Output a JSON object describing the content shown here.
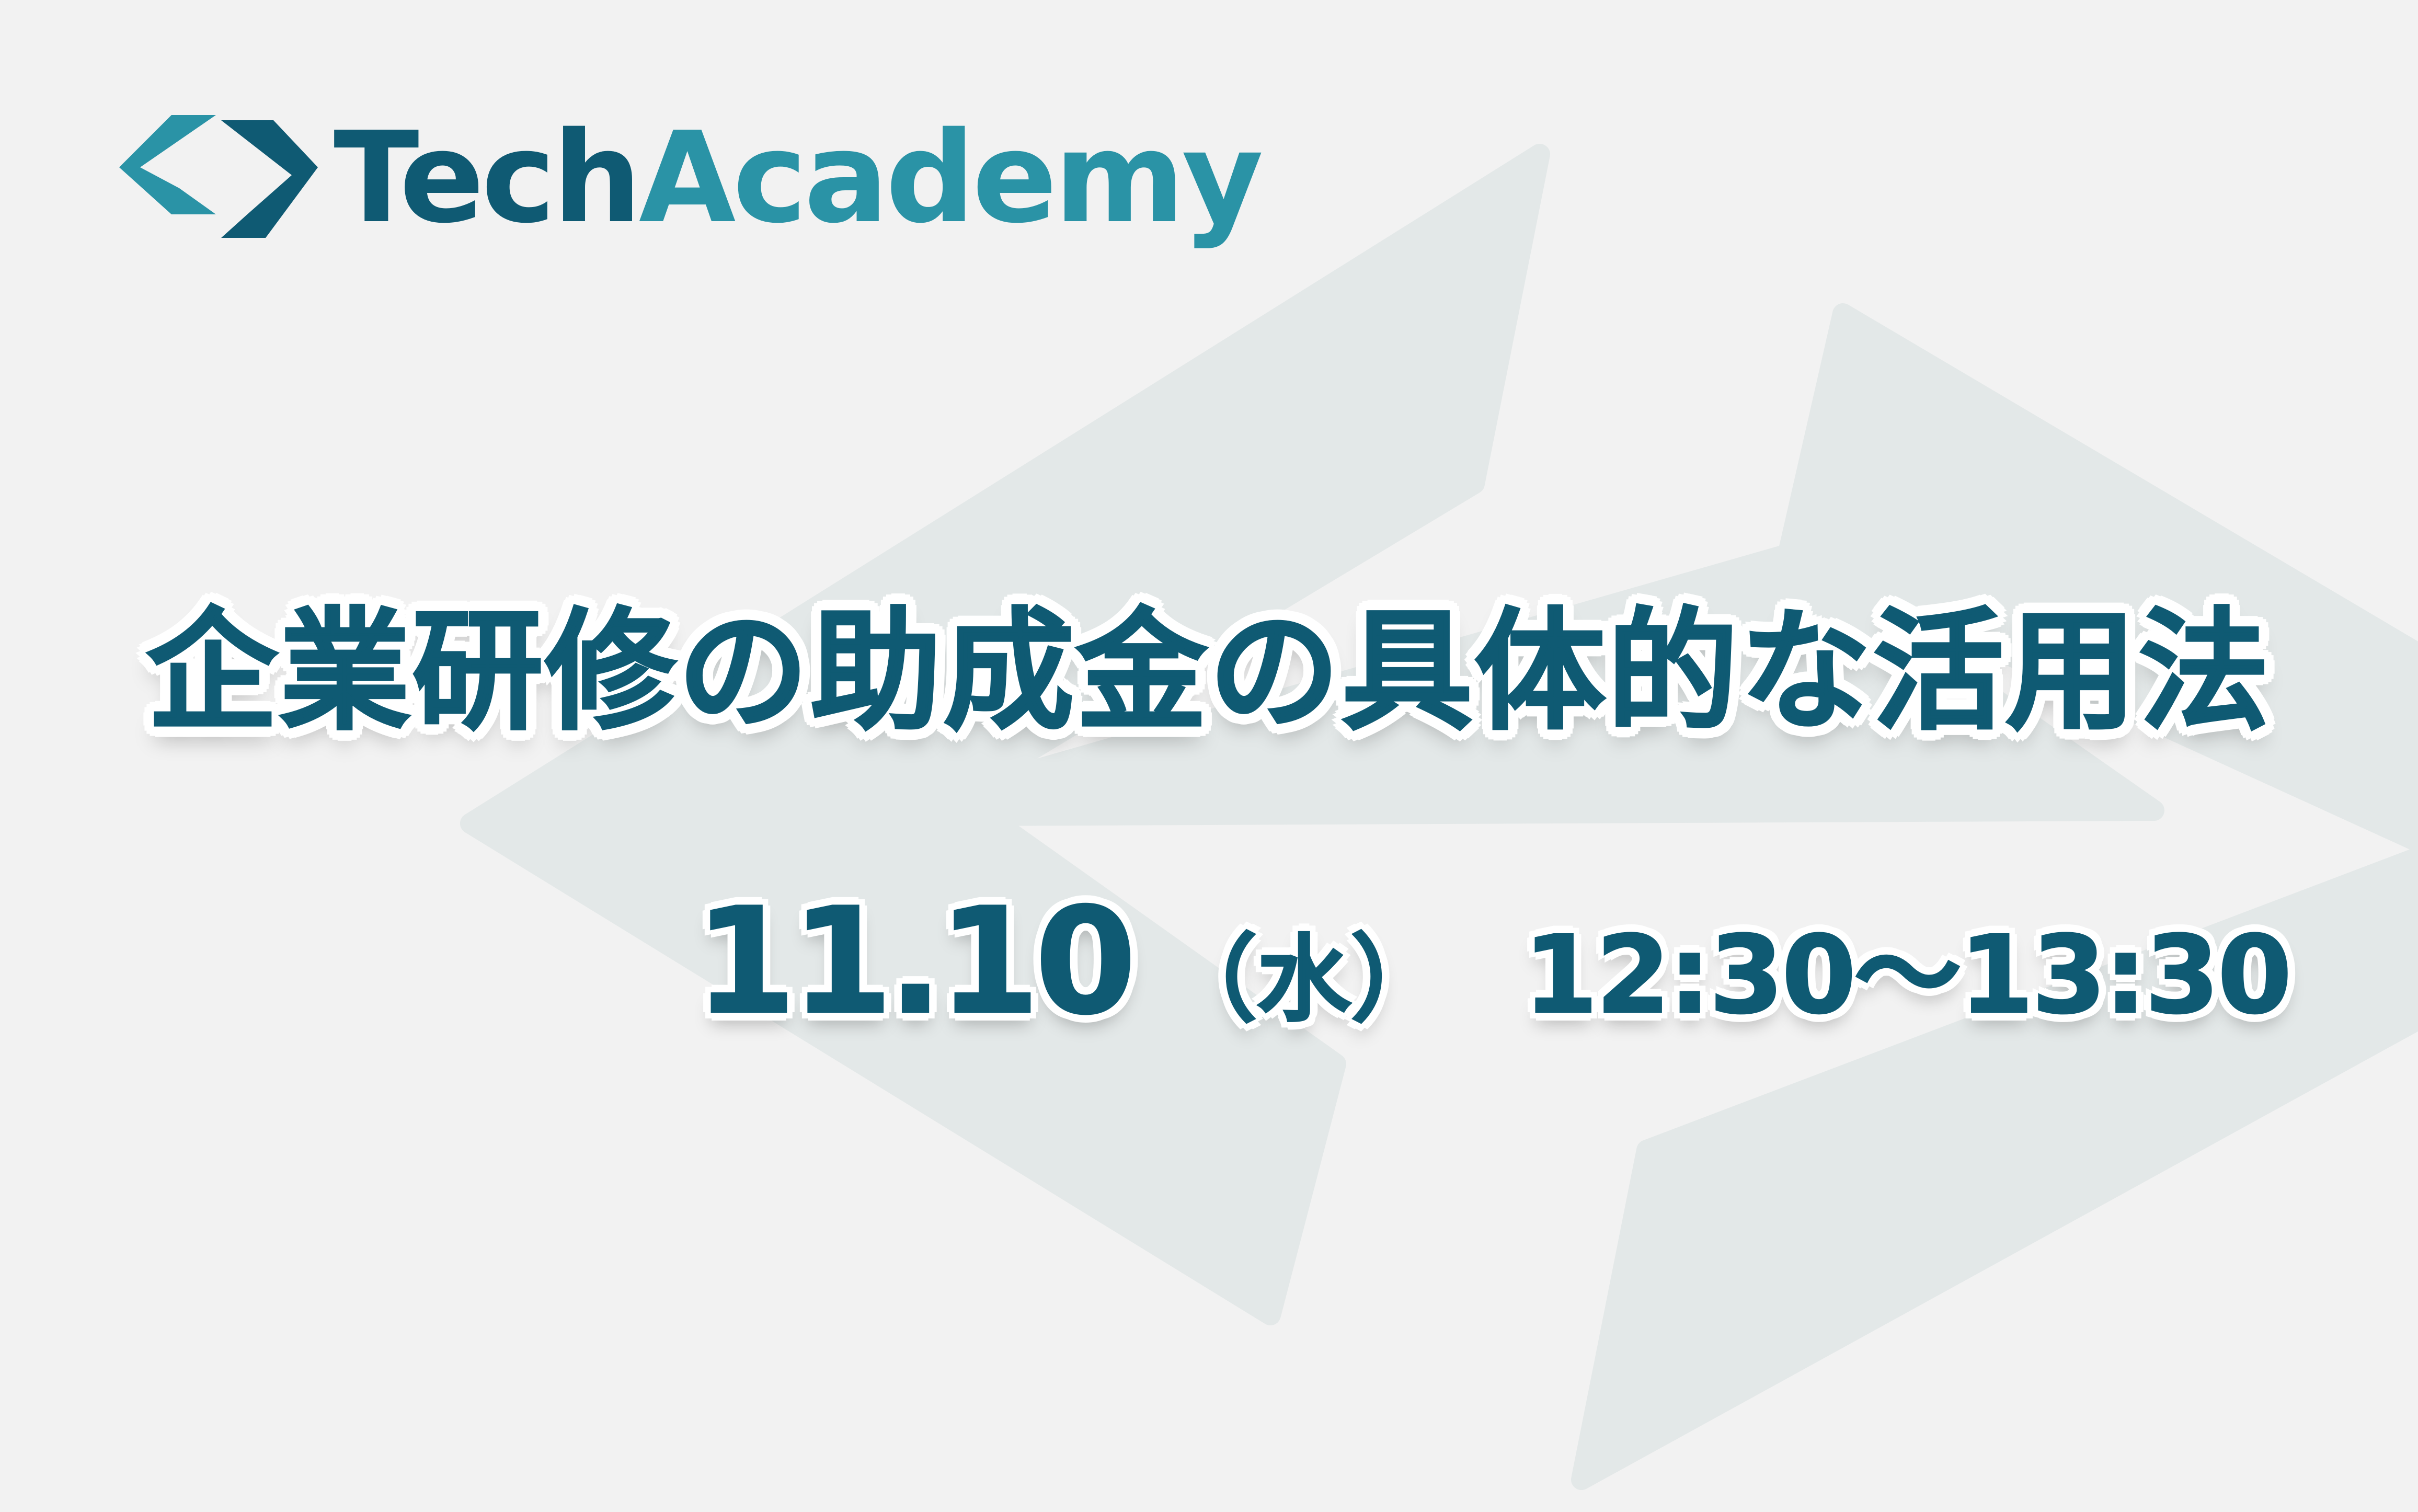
{
  "brand": {
    "name_part1": "Tech",
    "name_part2": "Academy",
    "logo_icon": "code-brackets-icon",
    "color_dark": "#0f5a73",
    "color_light": "#2a93a6"
  },
  "event": {
    "title": "企業研修の助成金の具体的な活用法",
    "date": "11.10",
    "weekday": "（水）",
    "time": "12:30～13:30"
  },
  "colors": {
    "background": "#f2f2f2",
    "watermark": "#e3e8e8",
    "text": "#0f5a73",
    "outline": "#ffffff"
  }
}
